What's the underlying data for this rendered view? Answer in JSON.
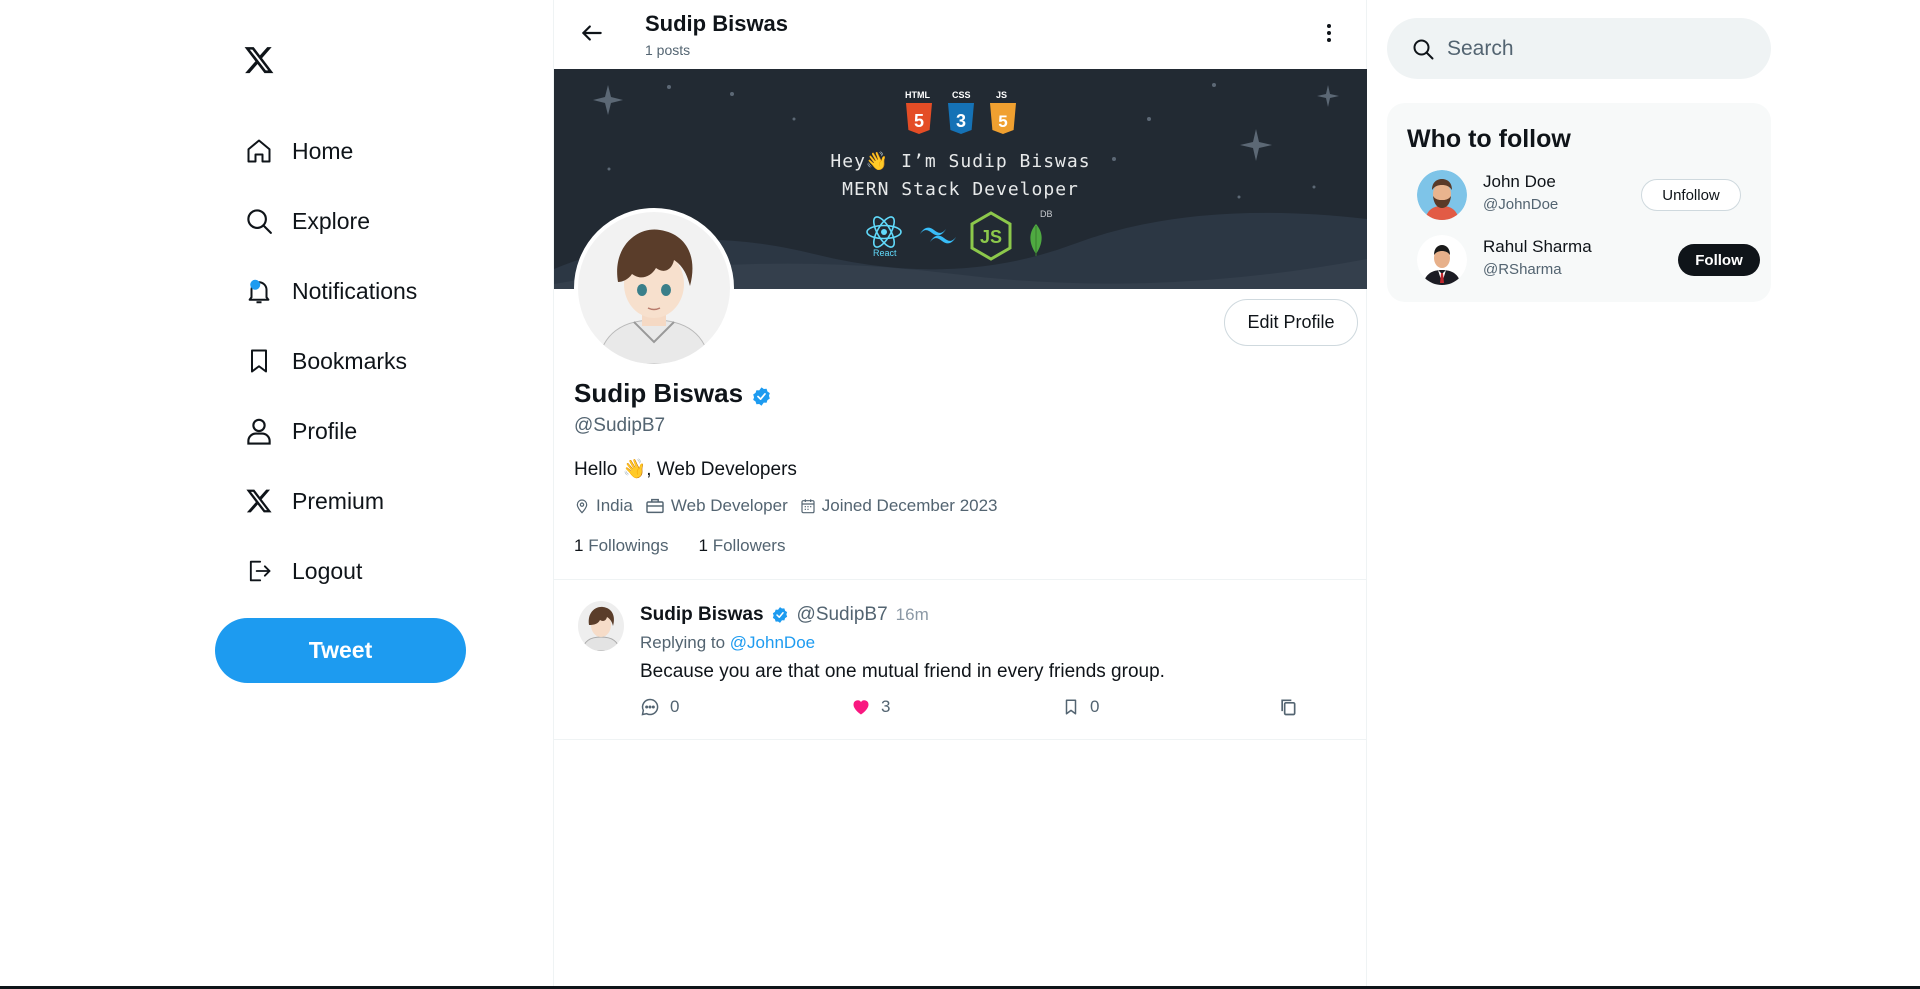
{
  "nav": {
    "logo_icon": "x-logo-icon",
    "items": [
      {
        "label": "Home",
        "icon": "home-icon"
      },
      {
        "label": "Explore",
        "icon": "search-icon"
      },
      {
        "label": "Notifications",
        "icon": "bell-icon"
      },
      {
        "label": "Bookmarks",
        "icon": "bookmark-icon"
      },
      {
        "label": "Profile",
        "icon": "user-icon"
      },
      {
        "label": "Premium",
        "icon": "x-logo-icon"
      },
      {
        "label": "Logout",
        "icon": "logout-icon"
      }
    ],
    "tweet_button": "Tweet"
  },
  "header": {
    "name": "Sudip Biswas",
    "posts": "1 posts"
  },
  "banner": {
    "line1": "Hey👋 I’m Sudip Biswas",
    "line2": "MERN Stack Developer",
    "badges": [
      "HTML",
      "CSS",
      "JS"
    ],
    "react_label": "React",
    "db_label": "DB"
  },
  "profile": {
    "edit_button": "Edit Profile",
    "name": "Sudip Biswas",
    "handle": "@SudipB7",
    "bio": "Hello 👋, Web Developers",
    "location": "India",
    "profession": "Web Developer",
    "joined": "Joined December 2023",
    "followings_count": "1",
    "followings_label": "Followings",
    "followers_count": "1",
    "followers_label": "Followers"
  },
  "tweet": {
    "name": "Sudip Biswas",
    "handle": "@SudipB7",
    "time": "16m",
    "replying_prefix": "Replying to",
    "replying_to": "@JohnDoe",
    "text": "Because you are that one mutual friend in every friends group.",
    "comments": "0",
    "likes": "3",
    "bookmarks": "0"
  },
  "search": {
    "placeholder": "Search"
  },
  "who_to_follow": {
    "title": "Who to follow",
    "users": [
      {
        "name": "John Doe",
        "handle": "@JohnDoe",
        "button": "Unfollow"
      },
      {
        "name": "Rahul Sharma",
        "handle": "@RSharma",
        "button": "Follow"
      }
    ]
  },
  "colors": {
    "accent": "#1d9bf0",
    "like": "#f91880",
    "banner_bg": "#222a33"
  }
}
